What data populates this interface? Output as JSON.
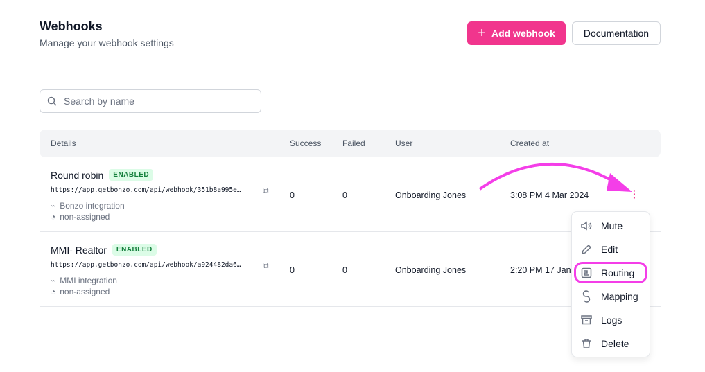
{
  "header": {
    "title": "Webhooks",
    "subtitle": "Manage your webhook settings",
    "add_button": "Add webhook",
    "docs_button": "Documentation"
  },
  "search": {
    "placeholder": "Search by name",
    "value": ""
  },
  "table": {
    "columns": [
      "Details",
      "Success",
      "Failed",
      "User",
      "Created at"
    ],
    "rows": [
      {
        "name": "Round robin",
        "status": "ENABLED",
        "url": "https://app.getbonzo.com/api/webhook/351b8a995e…",
        "integration": "Bonzo integration",
        "assignment": "non-assigned",
        "success": "0",
        "failed": "0",
        "user": "Onboarding Jones",
        "created": "3:08 PM 4 Mar 2024"
      },
      {
        "name": "MMI- Realtor",
        "status": "ENABLED",
        "url": "https://app.getbonzo.com/api/webhook/a924482da6…",
        "integration": "MMI integration",
        "assignment": "non-assigned",
        "success": "0",
        "failed": "0",
        "user": "Onboarding Jones",
        "created": "2:20 PM 17 Jan"
      }
    ]
  },
  "menu": {
    "items": [
      "Mute",
      "Edit",
      "Routing",
      "Mapping",
      "Logs",
      "Delete"
    ],
    "highlighted": "Routing"
  },
  "colors": {
    "accent": "#f1358d",
    "annotation": "#f43ee8",
    "badge_bg": "#dcfce7",
    "badge_text": "#15803d"
  }
}
